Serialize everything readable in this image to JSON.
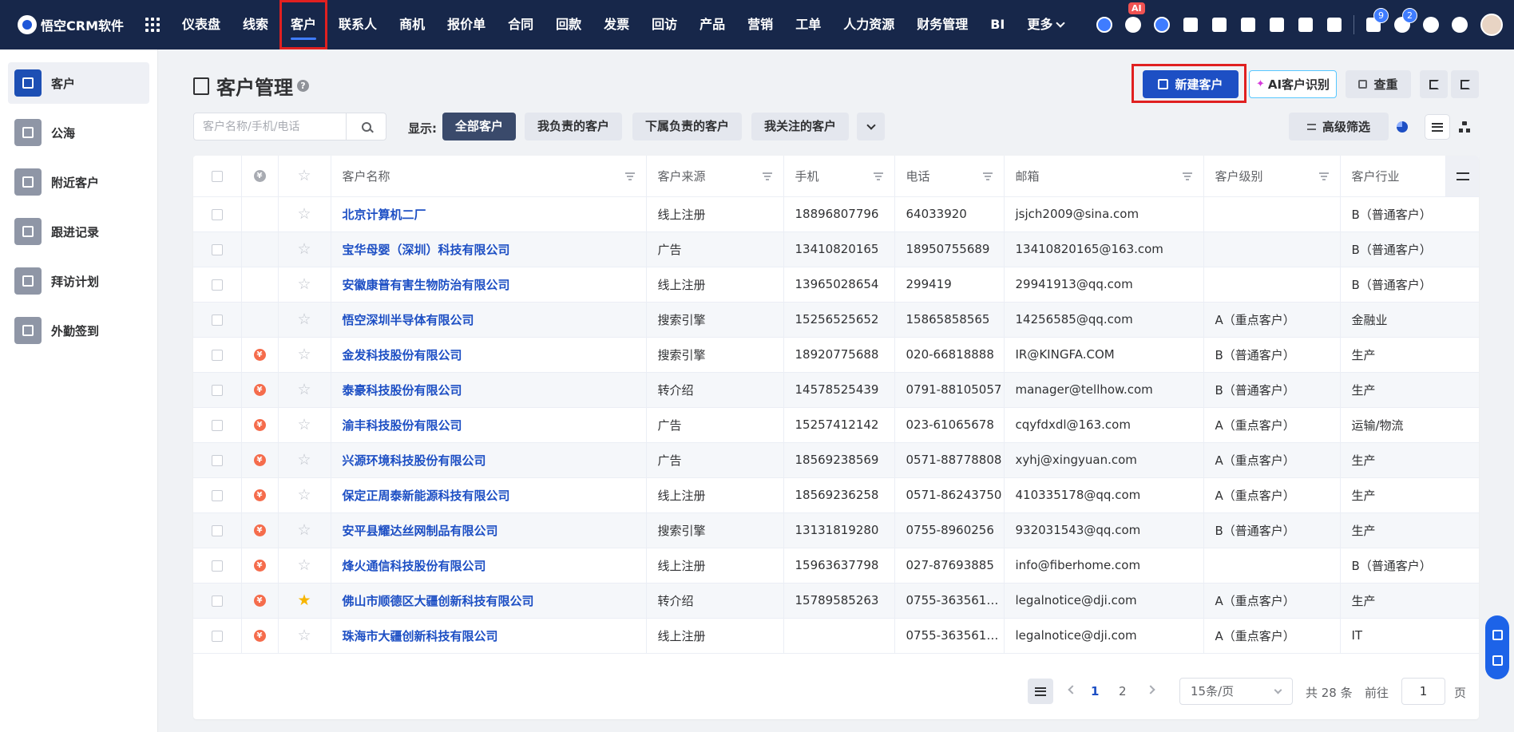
{
  "topbar": {
    "logo_text": "悟空CRM软件",
    "nav": [
      "仪表盘",
      "线索",
      "客户",
      "联系人",
      "商机",
      "报价单",
      "合同",
      "回款",
      "发票",
      "回访",
      "产品",
      "营销",
      "工单",
      "人力资源",
      "财务管理",
      "BI"
    ],
    "more_label": "更多",
    "ai_badge": "AI",
    "message_count": "9",
    "notice_count": "2"
  },
  "sidebar": {
    "items": [
      "客户",
      "公海",
      "附近客户",
      "跟进记录",
      "拜访计划",
      "外勤签到"
    ]
  },
  "header": {
    "title": "客户管理",
    "help": "?",
    "new_button": "新建客户",
    "ai_button": "AI客户识别",
    "ai_spark": "✦",
    "check_button": "查重"
  },
  "toolbar": {
    "search_placeholder": "客户名称/手机/电话",
    "show_label": "显示:",
    "filters": [
      "全部客户",
      "我负责的客户",
      "下属负责的客户",
      "我关注的客户"
    ],
    "advanced_filter": "高级筛选"
  },
  "table": {
    "deal_glyph": "¥",
    "star_glyph": "☆",
    "star_filled_glyph": "★",
    "columns": [
      "客户名称",
      "客户来源",
      "手机",
      "电话",
      "邮箱",
      "客户级别",
      "客户行业"
    ],
    "rows": [
      {
        "deal": false,
        "star": false,
        "name": "北京计算机二厂",
        "source": "线上注册",
        "mobile": "18896807796",
        "phone": "64033920",
        "email": "jsjch2009@sina.com",
        "level": "",
        "industry": "B（普通客户）"
      },
      {
        "deal": false,
        "star": false,
        "name": "宝华母婴（深圳）科技有限公司",
        "source": "广告",
        "mobile": "13410820165",
        "phone": "18950755689",
        "email": "13410820165@163.com",
        "level": "",
        "industry": "B（普通客户）"
      },
      {
        "deal": false,
        "star": false,
        "name": "安徽康普有害生物防治有限公司",
        "source": "线上注册",
        "mobile": "13965028654",
        "phone": "299419",
        "email": "29941913@qq.com",
        "level": "",
        "industry": "B（普通客户）"
      },
      {
        "deal": false,
        "star": false,
        "name": "悟空深圳半导体有限公司",
        "source": "搜索引擎",
        "mobile": "15256525652",
        "phone": "15865858565",
        "email": "14256585@qq.com",
        "level": "A（重点客户）",
        "industry": "金融业"
      },
      {
        "deal": true,
        "star": false,
        "name": "金发科技股份有限公司",
        "source": "搜索引擎",
        "mobile": "18920775688",
        "phone": "020-66818888",
        "email": "IR@KINGFA.COM",
        "level": "B（普通客户）",
        "industry": "生产"
      },
      {
        "deal": true,
        "star": false,
        "name": "泰豪科技股份有限公司",
        "source": "转介绍",
        "mobile": "14578525439",
        "phone": "0791-88105057",
        "email": "manager@tellhow.com",
        "level": "B（普通客户）",
        "industry": "生产"
      },
      {
        "deal": true,
        "star": false,
        "name": "渝丰科技股份有限公司",
        "source": "广告",
        "mobile": "15257412142",
        "phone": "023-61065678",
        "email": "cqyfdxdl@163.com",
        "level": "A（重点客户）",
        "industry": "运输/物流"
      },
      {
        "deal": true,
        "star": false,
        "name": "兴源环境科技股份有限公司",
        "source": "广告",
        "mobile": "18569238569",
        "phone": "0571-88778808",
        "email": "xyhj@xingyuan.com",
        "level": "A（重点客户）",
        "industry": "生产"
      },
      {
        "deal": true,
        "star": false,
        "name": "保定正周泰新能源科技有限公司",
        "source": "线上注册",
        "mobile": "18569236258",
        "phone": "0571-86243750",
        "email": "410335178@qq.com",
        "level": "A（重点客户）",
        "industry": "生产"
      },
      {
        "deal": true,
        "star": false,
        "name": "安平县耀达丝网制品有限公司",
        "source": "搜索引擎",
        "mobile": "13131819280",
        "phone": "0755-8960256",
        "email": "932031543@qq.com",
        "level": "B（普通客户）",
        "industry": "生产"
      },
      {
        "deal": true,
        "star": false,
        "name": "烽火通信科技股份有限公司",
        "source": "线上注册",
        "mobile": "15963637798",
        "phone": "027-87693885",
        "email": "info@fiberhome.com",
        "level": "",
        "industry": "B（普通客户）"
      },
      {
        "deal": true,
        "star": true,
        "name": "佛山市顺德区大疆创新科技有限公司",
        "source": "转介绍",
        "mobile": "15789585263",
        "phone": "0755-3635617...",
        "email": "legalnotice@dji.com",
        "level": "A（重点客户）",
        "industry": "生产"
      },
      {
        "deal": true,
        "star": false,
        "name": "珠海市大疆创新科技有限公司",
        "source": "线上注册",
        "mobile": "",
        "phone": "0755-3635617...",
        "email": "legalnotice@dji.com",
        "level": "A（重点客户）",
        "industry": "IT"
      }
    ]
  },
  "pagination": {
    "pages": [
      "1",
      "2"
    ],
    "current": "1",
    "page_size": "15条/页",
    "total": "共 28 条",
    "goto_label": "前往",
    "goto_value": "1",
    "page_unit": "页"
  }
}
